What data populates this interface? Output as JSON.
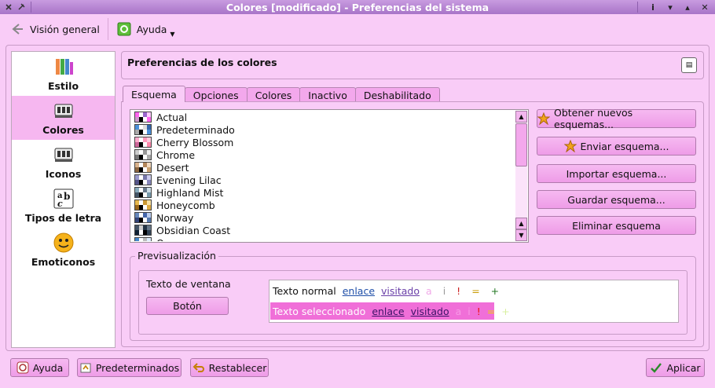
{
  "window": {
    "title": "Colores [modificado] - Preferencias del sistema",
    "icons": [
      "system-menu-icon",
      "pin-icon",
      "help-icon",
      "minimize-icon",
      "maximize-icon",
      "close-icon"
    ]
  },
  "toolbar": {
    "overview_label": "Visión general",
    "help_label": "Ayuda"
  },
  "sidebar": {
    "items": [
      {
        "label": "Estilo",
        "icon": "style-icon",
        "active": false
      },
      {
        "label": "Colores",
        "icon": "colors-icon",
        "active": true
      },
      {
        "label": "Iconos",
        "icon": "icons-icon",
        "active": false
      },
      {
        "label": "Tipos de letra",
        "icon": "fonts-icon",
        "active": false
      },
      {
        "label": "Emoticonos",
        "icon": "emoticons-icon",
        "active": false
      }
    ]
  },
  "header": {
    "title": "Preferencias de los colores"
  },
  "tabs": [
    {
      "label": "Esquema",
      "active": true
    },
    {
      "label": "Opciones",
      "active": false
    },
    {
      "label": "Colores",
      "active": false
    },
    {
      "label": "Inactivo",
      "active": false
    },
    {
      "label": "Deshabilitado",
      "active": false
    }
  ],
  "schemes": [
    {
      "name": "Actual",
      "colors": [
        "#ff66ee",
        "#ffffff",
        "#9966cc",
        "#ffccff",
        "#cc99cc",
        "#000000",
        "#ffffff",
        "#ff66ee"
      ]
    },
    {
      "name": "Predeterminado",
      "colors": [
        "#4a90d9",
        "#ffffff",
        "#dddddd",
        "#3366aa",
        "#aaaaaa",
        "#000000",
        "#ffffff",
        "#4a90d9"
      ]
    },
    {
      "name": "Cherry Blossom",
      "colors": [
        "#ffaacc",
        "#ffffff",
        "#ff99bb",
        "#ffccdd",
        "#cc6699",
        "#000000",
        "#ffffff",
        "#ff88aa"
      ]
    },
    {
      "name": "Chrome",
      "colors": [
        "#cccccc",
        "#ffffff",
        "#999999",
        "#eeeeee",
        "#777777",
        "#000000",
        "#ffffff",
        "#aaaaaa"
      ]
    },
    {
      "name": "Desert",
      "colors": [
        "#d9b38c",
        "#ffffff",
        "#b38659",
        "#f2d9bf",
        "#8c6640",
        "#000000",
        "#ffffff",
        "#c9a070"
      ]
    },
    {
      "name": "Evening Lilac",
      "colors": [
        "#9999cc",
        "#ffffff",
        "#7777aa",
        "#ccccee",
        "#555588",
        "#000000",
        "#ffffff",
        "#8888bb"
      ]
    },
    {
      "name": "Highland Mist",
      "colors": [
        "#88aabb",
        "#ffffff",
        "#667788",
        "#ccdde6",
        "#445566",
        "#000000",
        "#ffffff",
        "#779aab"
      ]
    },
    {
      "name": "Honeycomb",
      "colors": [
        "#e6b84d",
        "#ffffff",
        "#cc9933",
        "#f7e0a3",
        "#996619",
        "#000000",
        "#ffffff",
        "#ddaa44"
      ]
    },
    {
      "name": "Norway",
      "colors": [
        "#6688bb",
        "#ffffff",
        "#4466aa",
        "#bbccee",
        "#334477",
        "#000000",
        "#ffffff",
        "#5577aa"
      ]
    },
    {
      "name": "Obsidian Coast",
      "colors": [
        "#445566",
        "#cccccc",
        "#223344",
        "#667788",
        "#112233",
        "#ffffff",
        "#000000",
        "#334455"
      ]
    },
    {
      "name": "Oxygen",
      "colors": [
        "#4488cc",
        "#ffffff",
        "#bbbbbb",
        "#ddeeff",
        "#888888",
        "#000000",
        "#ffffff",
        "#3377bb"
      ]
    }
  ],
  "actions": {
    "get_new": "Obtener nuevos esquemas...",
    "send": "Enviar esquema...",
    "import": "Importar esquema...",
    "save": "Guardar esquema...",
    "remove": "Eliminar esquema"
  },
  "preview": {
    "legend": "Previsualización",
    "window_text": "Texto de ventana",
    "button_label": "Botón",
    "normal": {
      "text": "Texto normal",
      "link": "enlace",
      "visited": "visitado",
      "extras": [
        "a",
        "i",
        "!",
        "=",
        "+"
      ]
    },
    "selected": {
      "text": "Texto seleccionado",
      "link": "enlace",
      "visited": "visitado",
      "extras": [
        "a",
        "i",
        "!",
        "=",
        "+"
      ]
    }
  },
  "bottom": {
    "help": "Ayuda",
    "defaults": "Predeterminados",
    "reset": "Restablecer",
    "apply": "Aplicar"
  }
}
